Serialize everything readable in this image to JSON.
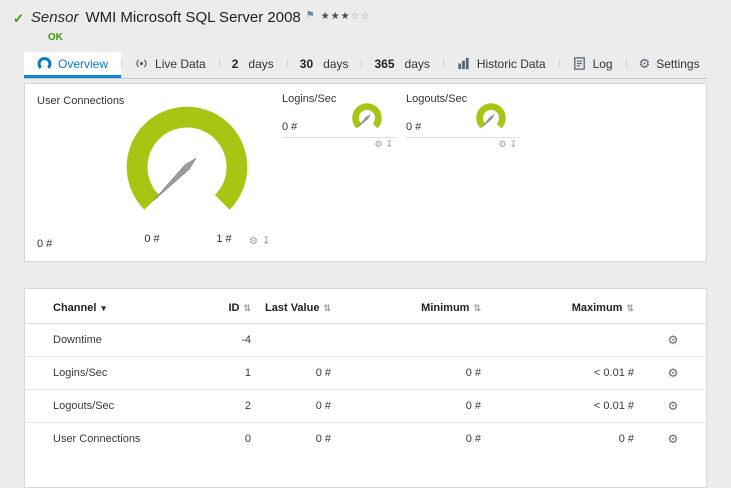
{
  "colors": {
    "gauge": "#a9c514",
    "accent_blue": "#0d86d0",
    "status_ok": "#3a9a00",
    "needle": "#9b9b9b"
  },
  "header": {
    "check_icon": "✓",
    "kind": "Sensor",
    "title": "WMI Microsoft SQL Server 2008",
    "flag_icon": "⚑",
    "stars_filled": "★★★",
    "stars_empty": "☆☆",
    "status": "OK"
  },
  "tabs": [
    {
      "label": "Overview"
    },
    {
      "label": "Live Data"
    },
    {
      "strong": "2",
      "label": "days"
    },
    {
      "strong": "30",
      "label": "days"
    },
    {
      "strong": "365",
      "label": "days"
    },
    {
      "label": "Historic Data"
    },
    {
      "label": "Log"
    },
    {
      "label": "Settings"
    }
  ],
  "panel": {
    "main_gauge": {
      "label": "User Connections",
      "value": "0 #",
      "min": "0 #",
      "max": "1 #"
    },
    "small_gauges": [
      {
        "label": "Logins/Sec",
        "value": "0 #"
      },
      {
        "label": "Logouts/Sec",
        "value": "0 #"
      }
    ]
  },
  "icons": {
    "gear": "⚙",
    "pin": "↧",
    "sort": "⇅",
    "dropdown": "▾"
  },
  "table": {
    "columns": {
      "channel": "Channel",
      "id": "ID",
      "last_value": "Last Value",
      "minimum": "Minimum",
      "maximum": "Maximum"
    },
    "rows": [
      {
        "channel": "Downtime",
        "id": "-4",
        "last": "",
        "min": "",
        "max": ""
      },
      {
        "channel": "Logins/Sec",
        "id": "1",
        "last": "0 #",
        "min": "0 #",
        "max": "< 0.01 #"
      },
      {
        "channel": "Logouts/Sec",
        "id": "2",
        "last": "0 #",
        "min": "0 #",
        "max": "< 0.01 #"
      },
      {
        "channel": "User Connections",
        "id": "0",
        "last": "0 #",
        "min": "0 #",
        "max": "0 #"
      }
    ]
  }
}
